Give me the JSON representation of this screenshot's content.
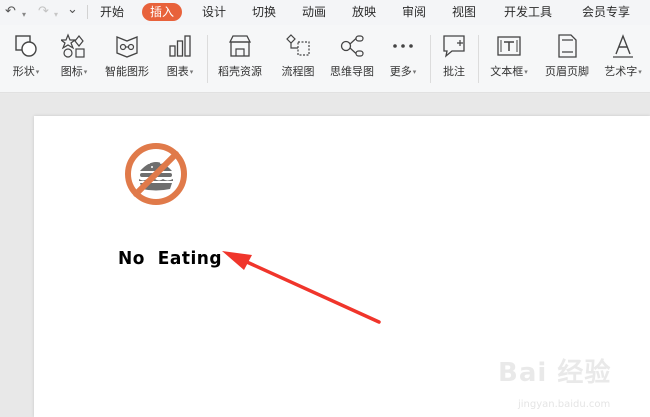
{
  "quick_access": {
    "undo": "↶",
    "undo_drop": "▾",
    "redo": "↷",
    "redo_drop": "▾",
    "more": "⌄"
  },
  "menu": {
    "tabs": [
      "开始",
      "插入",
      "设计",
      "切换",
      "动画",
      "放映",
      "审阅",
      "视图",
      "开发工具",
      "会员专享"
    ],
    "active_tab": "插入"
  },
  "ribbon": {
    "shape": "形状",
    "icon": "图标",
    "smartart": "智能图形",
    "chart": "图表",
    "docer": "稻壳资源",
    "flowchart": "流程图",
    "mindmap": "思维导图",
    "more": "更多",
    "comment": "批注",
    "textbox": "文本框",
    "header_footer": "页眉页脚",
    "wordart": "艺术字",
    "caret": "▾"
  },
  "slide": {
    "caption": "No  Eating"
  },
  "watermark": {
    "logo": "Bai 经验",
    "sub": "jingyan.baidu.com",
    "url": "jingyan.baidu.com"
  },
  "colors": {
    "accent": "#e8623b",
    "arrow": "#f0352b",
    "prohibit": "#e07a4a",
    "burger": "#6e6e6e"
  }
}
